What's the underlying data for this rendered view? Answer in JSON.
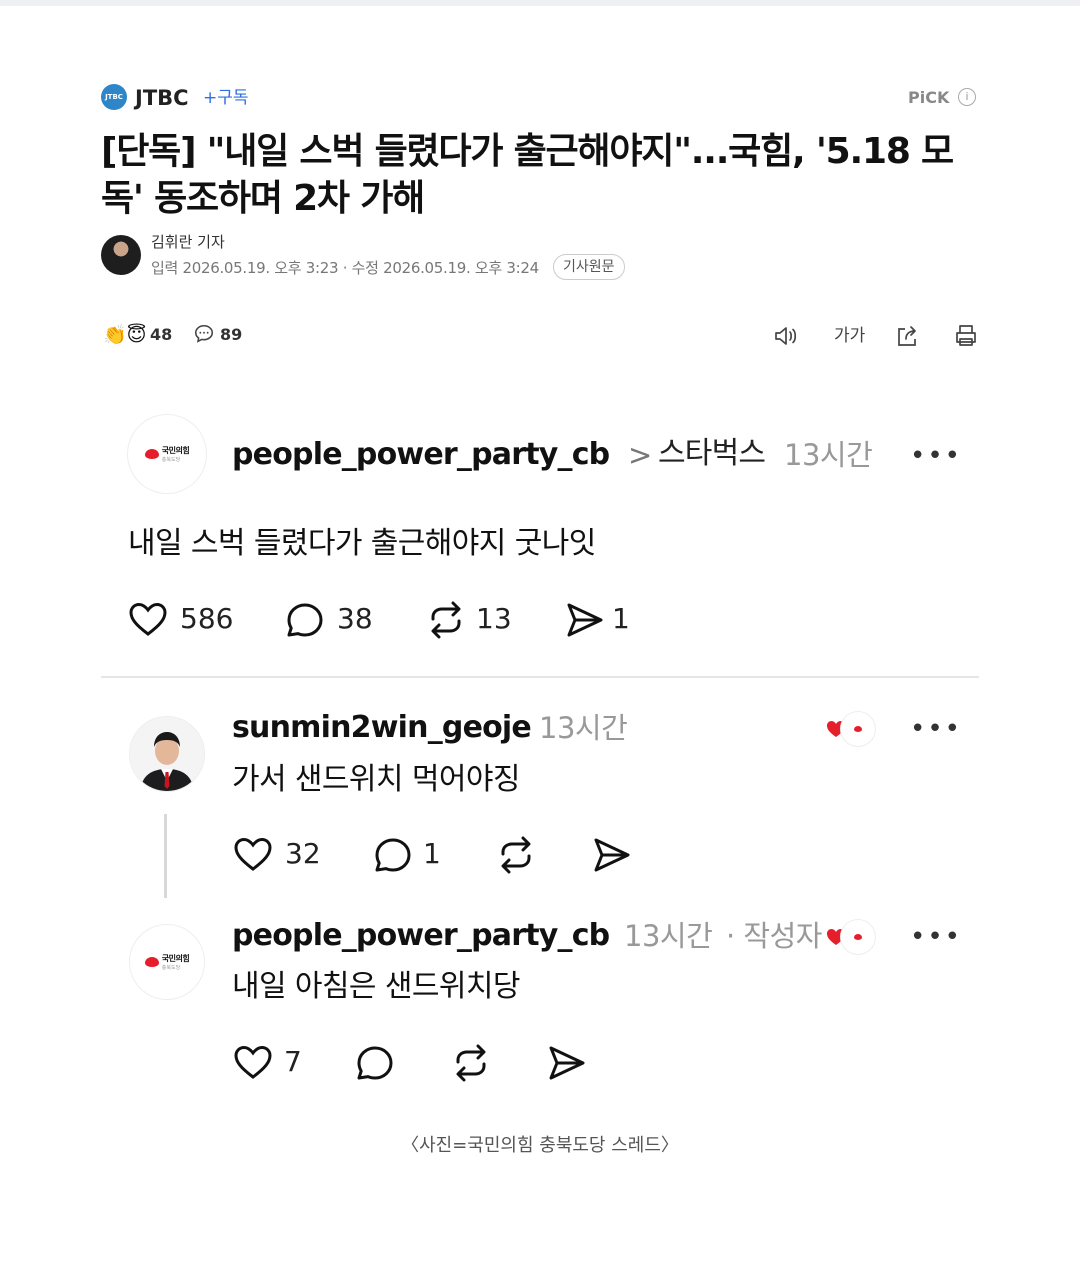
{
  "article": {
    "press": {
      "name": "JTBC",
      "logo_text": "JTBC",
      "subscribe": "+구독"
    },
    "pick": {
      "label": "PiCK",
      "info_icon": "info-icon"
    },
    "headline": "[단독] \"내일 스벅 들렸다가 출근해야지\"...국힘, '5.18 모독' 동조하며 2차 가해",
    "reporter": "김휘란 기자",
    "dates": "입력 2026.05.19. 오후 3:23 · 수정 2026.05.19. 오후 3:24",
    "original_button": "기사원문",
    "reactions": {
      "emoji": "👏😇",
      "count": "48"
    },
    "comments": {
      "icon": "comment-bubble-icon",
      "count": "89"
    },
    "toolbar": {
      "audio_icon": "speaker-icon",
      "font_label": "가가",
      "share_icon": "share-icon",
      "print_icon": "print-icon"
    }
  },
  "threads": {
    "post": {
      "logo_text": "국민의힘",
      "logo_sub": "충북도당",
      "username": "people_power_party_cb",
      "separator": ">",
      "topic": "스타벅스",
      "time": "13시간",
      "more": "•••",
      "text": "내일 스벅 들렸다가 출근해야지 굿나잇",
      "stats": {
        "likes": "586",
        "replies": "38",
        "reposts": "13",
        "shares": "1"
      }
    },
    "reply1": {
      "username": "sunmin2win_geoje",
      "time": "13시간",
      "more": "•••",
      "text": "가서 샌드위치 먹어야징",
      "stats": {
        "likes": "32",
        "replies": "1"
      }
    },
    "reply2": {
      "logo_text": "국민의힘",
      "logo_sub": "충북도당",
      "username": "people_power_party_cb",
      "time": "13시간",
      "author_tag": "· 작성자",
      "more": "•••",
      "text": "내일 아침은 샌드위치당",
      "stats": {
        "likes": "7"
      }
    }
  },
  "caption": "〈사진=국민의힘 충북도당 스레드〉",
  "colors": {
    "accent_blue": "#2f6fe0",
    "party_red": "#e61e2b",
    "jtbc_blue": "#2e86c9"
  }
}
